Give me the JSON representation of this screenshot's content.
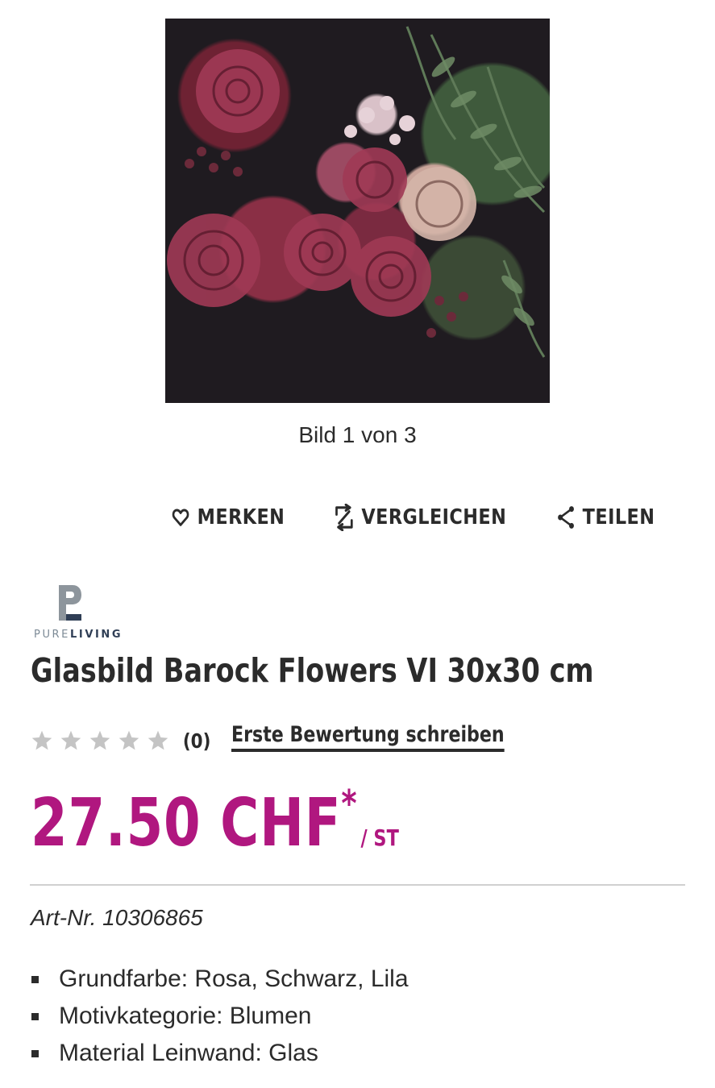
{
  "gallery": {
    "image_alt": "Glasbild Barock Flowers VI",
    "counter_text": "Bild 1 von 3"
  },
  "actions": {
    "merken": "MERKEN",
    "vergleichen": "VERGLEICHEN",
    "teilen": "TEILEN"
  },
  "brand": {
    "name_part1": "PURE",
    "name_part2": "LIVING"
  },
  "product": {
    "title": "Glasbild Barock Flowers VI 30x30 cm",
    "rating": {
      "stars_filled": 0,
      "stars_total": 5,
      "count_text": "(0)",
      "write_review_label": "Erste Bewertung schreiben"
    },
    "price": {
      "amount": "27.50 CHF",
      "asterisk": "*",
      "unit": "/ ST"
    },
    "article_number": "Art-Nr. 10306865",
    "features": [
      "Grundfarbe: Rosa, Schwarz, Lila",
      "Motivkategorie: Blumen",
      "Material Leinwand: Glas"
    ]
  },
  "colors": {
    "price": "#b0177f",
    "text": "#2b2b2b",
    "star_empty": "#c4c4c4"
  }
}
